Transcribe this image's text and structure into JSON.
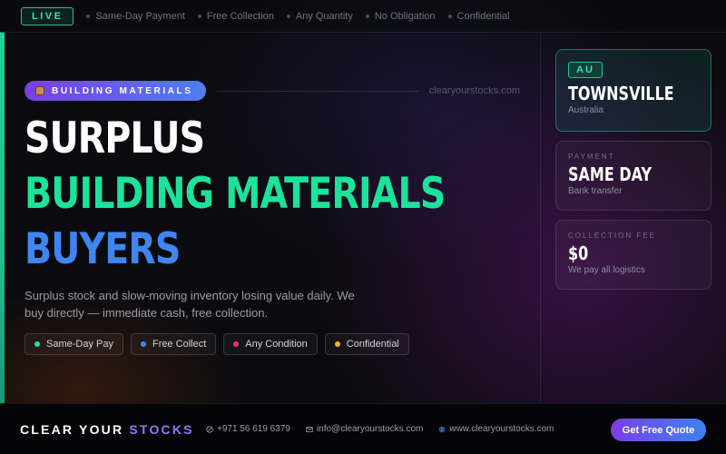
{
  "topbar": {
    "live_label": "LIVE",
    "items": [
      "Same-Day Payment",
      "Free Collection",
      "Any Quantity",
      "No Obligation",
      "Confidential"
    ]
  },
  "hero": {
    "tag": "BUILDING MATERIALS",
    "tag_icon": "bricks-icon",
    "domain": "clearyourstocks.com",
    "headline": [
      "SURPLUS",
      "BUILDING MATERIALS",
      "BUYERS"
    ],
    "description": "Surplus stock and slow-moving inventory losing value daily. We buy directly — immediate cash, free collection.",
    "chips": [
      {
        "label": "Same-Day Pay",
        "color": "#22e3a0"
      },
      {
        "label": "Free Collect",
        "color": "#3f86f2"
      },
      {
        "label": "Any Condition",
        "color": "#f0336e"
      },
      {
        "label": "Confidential",
        "color": "#f2b632"
      }
    ]
  },
  "cards": {
    "location": {
      "badge": "AU",
      "title": "TOWNSVILLE",
      "subtitle": "Australia"
    },
    "payment": {
      "label": "PAYMENT",
      "title": "SAME DAY",
      "subtitle": "Bank transfer"
    },
    "fee": {
      "label": "COLLECTION FEE",
      "title": "$0",
      "subtitle": "We pay all logistics"
    }
  },
  "footer": {
    "brand_part1": "CLEAR YOUR",
    "brand_part2": "STOCKS",
    "phone": "+971 56 619 6379",
    "email": "info@clearyourstocks.com",
    "website": "www.clearyourstocks.com",
    "cta": "Get Free Quote"
  },
  "colors": {
    "accent_green": "#1be39a",
    "accent_blue": "#3f86f2",
    "accent_purple": "#7b3fe4"
  }
}
